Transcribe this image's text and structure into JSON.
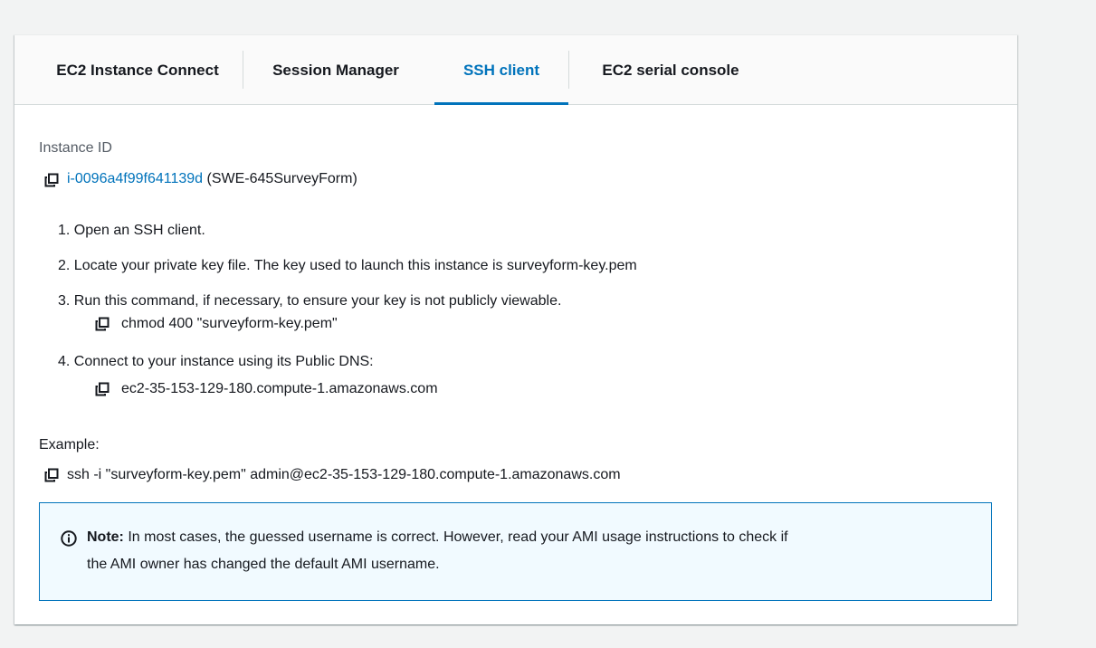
{
  "tabs": [
    {
      "label": "EC2 Instance Connect"
    },
    {
      "label": "Session Manager"
    },
    {
      "label": "SSH client"
    },
    {
      "label": "EC2 serial console"
    }
  ],
  "active_tab": "SSH client",
  "instance": {
    "label": "Instance ID",
    "id": "i-0096a4f99f641139d",
    "name": "(SWE-645SurveyForm)"
  },
  "steps": [
    {
      "text": "1. Open an SSH client."
    },
    {
      "text": "2. Locate your private key file. The key used to launch this instance is surveyform-key.pem"
    },
    {
      "text": "3. Run this command, if necessary, to ensure your key is not publicly viewable.",
      "command": "chmod 400 \"surveyform-key.pem\""
    },
    {
      "text": "4. Connect to your instance using its Public DNS:",
      "command": "ec2-35-153-129-180.compute-1.amazonaws.com"
    }
  ],
  "example": {
    "label": "Example:",
    "command": "ssh -i \"surveyform-key.pem\" admin@ec2-35-153-129-180.compute-1.amazonaws.com"
  },
  "note": {
    "bold": "Note:",
    "line1": " In most cases, the guessed username is correct. However, read your AMI usage instructions to check if",
    "line2": "the AMI owner has changed the default AMI username."
  },
  "colors": {
    "accent": "#0073bb",
    "note_background": "#f1faff",
    "page_background": "#f2f3f3"
  },
  "icons": [
    "copy-icon",
    "info-icon"
  ]
}
